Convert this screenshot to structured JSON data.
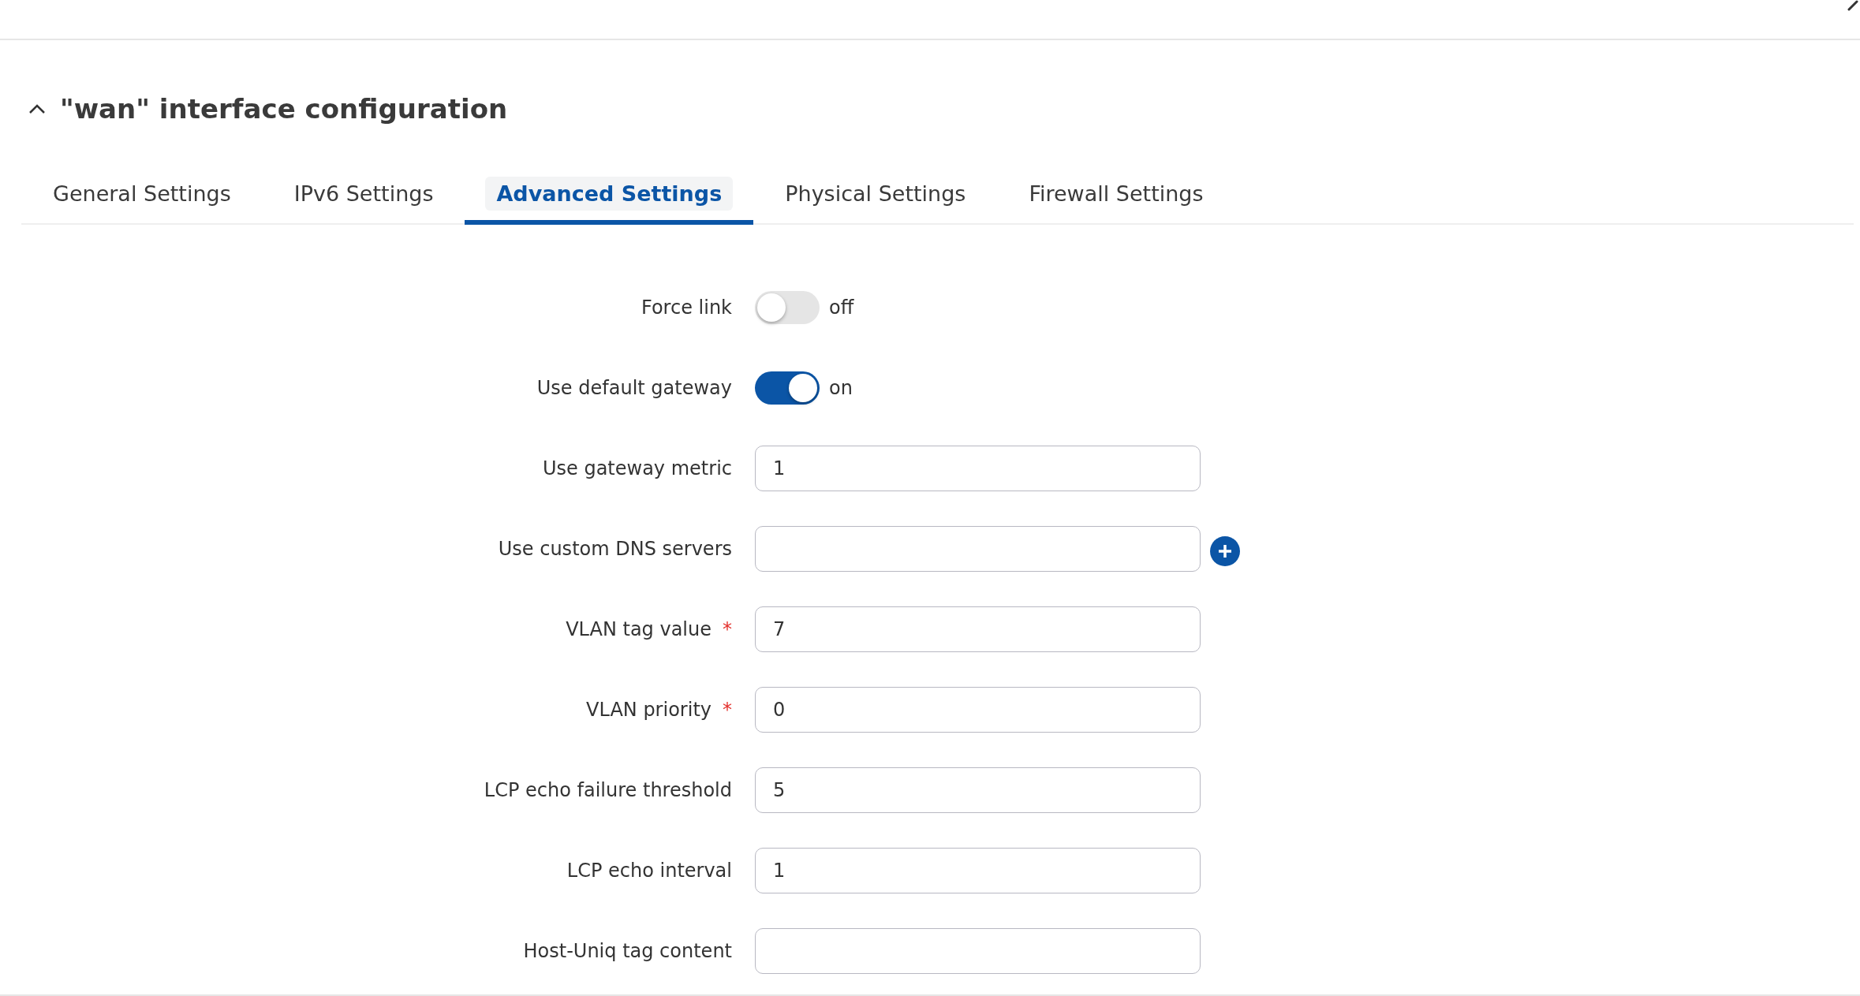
{
  "section": {
    "title": "\"wan\" interface configuration",
    "expanded": true
  },
  "tabs": [
    {
      "label": "General Settings",
      "selected": false
    },
    {
      "label": "IPv6 Settings",
      "selected": false
    },
    {
      "label": "Advanced Settings",
      "selected": true
    },
    {
      "label": "Physical Settings",
      "selected": false
    },
    {
      "label": "Firewall Settings",
      "selected": false
    }
  ],
  "fields": [
    {
      "kind": "toggle",
      "label": "Force link",
      "on": false,
      "state_text": "off"
    },
    {
      "kind": "toggle",
      "label": "Use default gateway",
      "on": true,
      "state_text": "on"
    },
    {
      "kind": "input",
      "label": "Use gateway metric",
      "value": "1"
    },
    {
      "kind": "input_add",
      "label": "Use custom DNS servers"
    },
    {
      "kind": "input",
      "label": "VLAN tag value",
      "value": "7",
      "required_mark": "*"
    },
    {
      "kind": "input",
      "label": "VLAN priority",
      "value": "0",
      "required_mark": "*"
    },
    {
      "kind": "input",
      "label": "LCP echo failure threshold",
      "value": "5"
    },
    {
      "kind": "input",
      "label": "LCP echo interval",
      "value": "1"
    },
    {
      "kind": "input",
      "label": "Host-Uniq tag content"
    }
  ]
}
